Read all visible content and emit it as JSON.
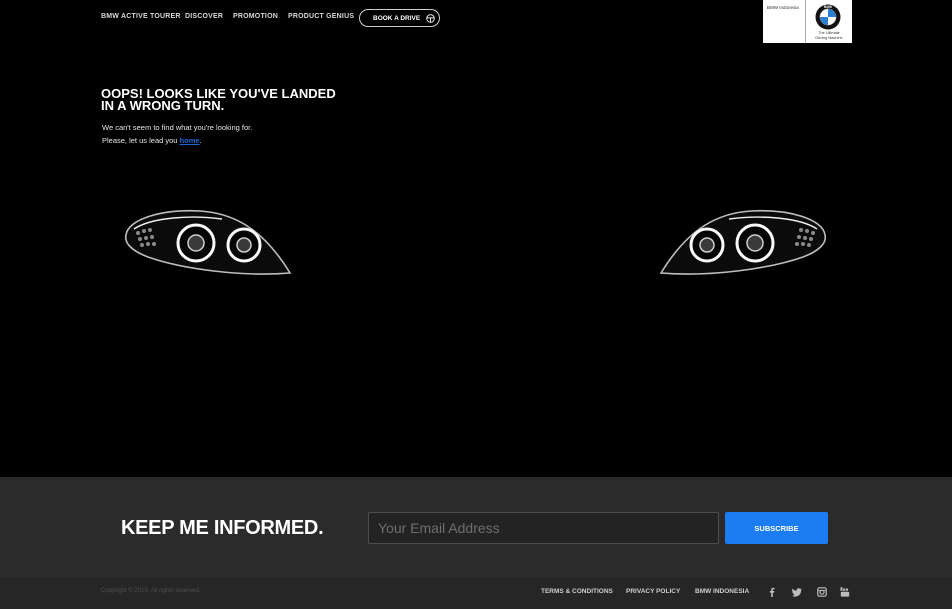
{
  "nav": {
    "items": [
      "BMW ACTIVE TOURER",
      "DISCOVER",
      "PROMOTION",
      "PRODUCT GENIUS"
    ],
    "book_label": "BOOK A DRIVE",
    "book_icon": "steering-wheel-icon"
  },
  "logo": {
    "brand_text": "BMW Indonesia",
    "roundel_letters": "BMW",
    "tagline_line1": "The Ultimate",
    "tagline_line2": "Driving Machine"
  },
  "error": {
    "title": "OOPS! LOOKS LIKE YOU'VE LANDED IN A WRONG TURN.",
    "line1": "We can't seem to find what you're looking for.",
    "line2_prefix": "Please, let us lead you ",
    "link_label": "home",
    "line2_suffix": "."
  },
  "newsletter": {
    "title": "KEEP ME INFORMED.",
    "email_placeholder": "Your Email Address",
    "email_value": "",
    "subscribe_label": "SUBSCRIBE"
  },
  "footer": {
    "copyright": "Copyright © 2015. All rights reserved.",
    "links": [
      "TERMS & CONDITIONS",
      "PRIVACY POLICY",
      "BMW INDONESIA"
    ],
    "social_icons": [
      "facebook-icon",
      "twitter-icon",
      "instagram-icon",
      "youtube-icon"
    ]
  },
  "colors": {
    "background": "#000000",
    "accent_blue": "#1c7cf4",
    "link_blue": "#1c69d4",
    "newsletter_bg": "#2b2b2b",
    "footer_bg": "#262626"
  }
}
